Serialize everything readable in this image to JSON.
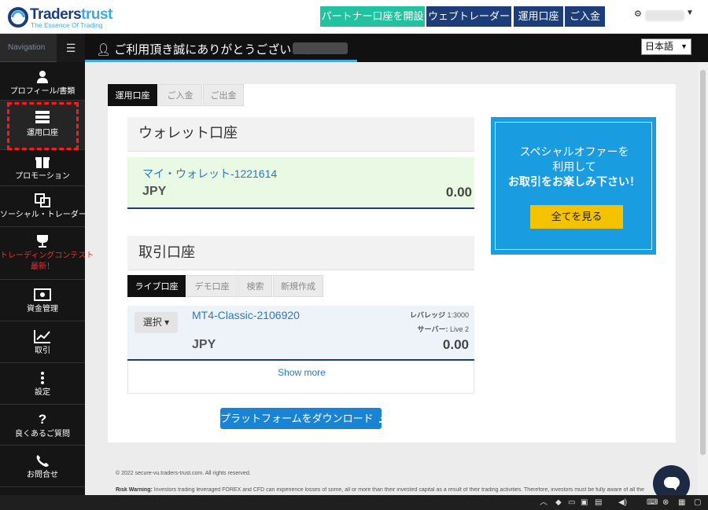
{
  "brand": {
    "name_part1": "Traders",
    "name_part2": "trust",
    "tagline": "The Essence Of Trading"
  },
  "topnav": {
    "partner_label": "パートナー口座を開設",
    "webtrader_label": "ウェブトレーダー",
    "accounts_label": "運用口座",
    "deposit_label": "ご入金"
  },
  "sidebar": {
    "header_label": "Navigation",
    "items": [
      {
        "label": "プロフィール/書類",
        "icon": "user-icon"
      },
      {
        "label": "運用口座",
        "icon": "accounts-icon"
      },
      {
        "label": "プロモーション",
        "icon": "gift-icon"
      },
      {
        "label": "ソーシャル・トレーダー",
        "icon": "social-icon"
      },
      {
        "label": "トレーディングコンテスト",
        "label2": "最新！",
        "icon": "trophy-icon"
      },
      {
        "label": "資金管理",
        "icon": "money-icon"
      },
      {
        "label": "取引",
        "icon": "chart-icon"
      },
      {
        "label": "設定",
        "icon": "dots-icon"
      },
      {
        "label": "良くあるご質問",
        "icon": "question-icon"
      },
      {
        "label": "お問合せ",
        "icon": "phone-icon"
      }
    ]
  },
  "welcome": {
    "text": "ご利用頂き誠にありがとうございます",
    "language": "日本語"
  },
  "main_tabs": [
    "運用口座",
    "ご入金",
    "ご出金"
  ],
  "wallet": {
    "title": "ウォレット口座",
    "name": "マイ・ウォレット-1221614",
    "currency": "JPY",
    "balance": "0.00"
  },
  "trading": {
    "title": "取引口座",
    "tabs": [
      "ライブ口座",
      "デモ口座",
      "検索",
      "新規作成"
    ],
    "account": {
      "select_label": "選択",
      "name": "MT4-Classic-2106920",
      "leverage_label": "レバレッジ",
      "leverage_value": "1:3000",
      "server_label": "サーバー:",
      "server_value": "Live 2",
      "currency": "JPY",
      "balance": "0.00"
    },
    "show_more": "Show more"
  },
  "download_label": "プラットフォームをダウンロード",
  "promo": {
    "line1": "スペシャルオファーを",
    "line2": "利用して",
    "line3": "お取引をお楽しみ下さい！",
    "button": "全てを見る"
  },
  "footer": {
    "copyright": "© 2022 secure-vu.traders-trust.com. All rights reserved.",
    "risk_title": "Risk Warning:",
    "risk_text": "Investors trading leveraged FOREX and CFD can experience losses of some, all or more than their invested capital as a result of their trading activities. Therefore, investors must be fully aware of all the"
  },
  "colors": {
    "navy": "#1d3d7a",
    "teal": "#21c2a0",
    "sky": "#3fa9e0",
    "promo_blue": "#1a9de0",
    "promo_yellow": "#f5c200",
    "link_blue": "#2a79c4",
    "warning_red": "#ff2a2a"
  }
}
